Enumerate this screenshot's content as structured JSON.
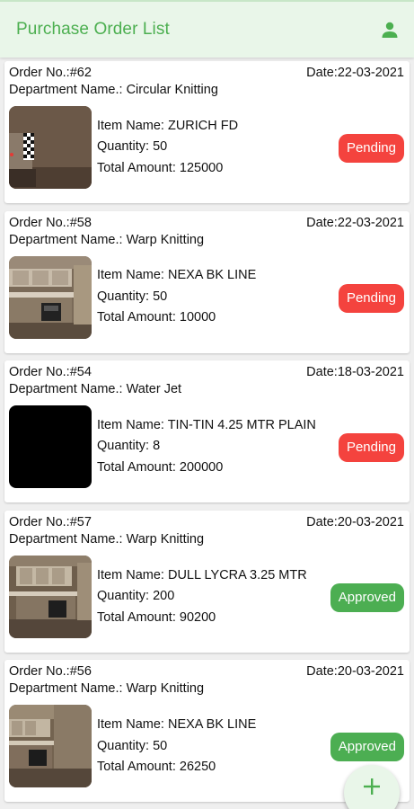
{
  "header": {
    "title": "Purchase Order List",
    "profile_icon": "person-icon",
    "accent": "#4caf50"
  },
  "labels": {
    "order_no": "Order No.:",
    "date": "Date:",
    "department": "Department Name.: ",
    "item_name": "Item Name: ",
    "quantity": "Quantity: ",
    "total_amount": "Total Amount: "
  },
  "orders": [
    {
      "order_no": "#62",
      "date": "22-03-2021",
      "department": "Circular Knitting",
      "item_name": "ZURICH FD",
      "quantity": "50",
      "total_amount": "125000",
      "status": "Pending",
      "image": "room-photo"
    },
    {
      "order_no": "#58",
      "date": "22-03-2021",
      "department": "Warp Knitting",
      "item_name": "NEXA BK LINE",
      "quantity": "50",
      "total_amount": "10000",
      "status": "Pending",
      "image": "kitchen-photo"
    },
    {
      "order_no": "#54",
      "date": "18-03-2021",
      "department": "Water Jet",
      "item_name": "TIN-TIN 4.25 MTR PLAIN",
      "quantity": "8",
      "total_amount": "200000",
      "status": "Pending",
      "image": "black-photo"
    },
    {
      "order_no": "#57",
      "date": "20-03-2021",
      "department": "Warp Knitting",
      "item_name": "DULL LYCRA 3.25 MTR",
      "quantity": "200",
      "total_amount": "90200",
      "status": "Approved",
      "image": "kitchen-photo"
    },
    {
      "order_no": "#56",
      "date": "20-03-2021",
      "department": "Warp Knitting",
      "item_name": "NEXA BK LINE",
      "quantity": "50",
      "total_amount": "26250",
      "status": "Approved",
      "image": "kitchen-photo"
    }
  ],
  "status_colors": {
    "Pending": "#f4433e",
    "Approved": "#4cae52"
  },
  "fab": {
    "icon": "plus-icon"
  }
}
